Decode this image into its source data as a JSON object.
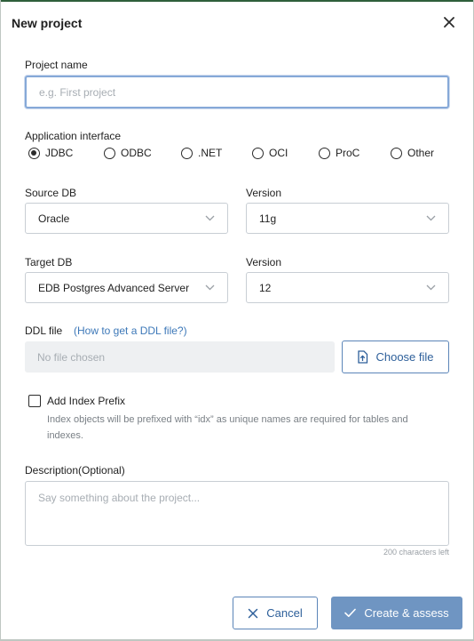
{
  "dialog": {
    "title": "New project"
  },
  "project_name": {
    "label": "Project name",
    "placeholder": "e.g. First project",
    "value": ""
  },
  "app_interface": {
    "label": "Application interface",
    "options": [
      "JDBC",
      "ODBC",
      ".NET",
      "OCI",
      "ProC",
      "Other"
    ],
    "selected": "JDBC"
  },
  "source_db": {
    "label": "Source DB",
    "value": "Oracle",
    "version_label": "Version",
    "version_value": "11g"
  },
  "target_db": {
    "label": "Target DB",
    "value": "EDB Postgres Advanced Server",
    "version_label": "Version",
    "version_value": "12"
  },
  "ddl": {
    "label": "DDL file",
    "help_link": "(How to get a DDL file?)",
    "file_status": "No file chosen",
    "choose_label": "Choose file"
  },
  "index_prefix": {
    "label": "Add Index Prefix",
    "checked": false,
    "help": "Index objects will be prefixed with “idx” as unique names are required for tables and indexes."
  },
  "description": {
    "label": "Description(Optional)",
    "placeholder": "Say something about the project...",
    "value": "",
    "counter": "200 characters left"
  },
  "footer": {
    "cancel_label": "Cancel",
    "create_label": "Create & assess"
  },
  "colors": {
    "primary_button": "#6f95c2",
    "outline": "#5b85b8",
    "link": "#3d78b8"
  },
  "icons": {
    "close": "close-icon",
    "chevron": "chevron-down-icon",
    "upload": "upload-file-icon",
    "cancel": "x-icon",
    "create": "check-icon"
  }
}
